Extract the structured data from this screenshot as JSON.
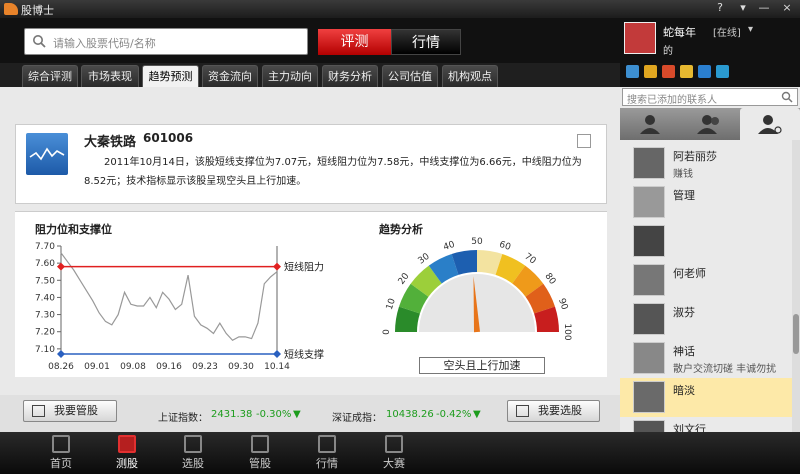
{
  "window": {
    "title": "股博士",
    "controls": [
      "?",
      "—",
      "×"
    ]
  },
  "search": {
    "placeholder": "请输入股票代码/名称"
  },
  "mode_tabs": [
    {
      "label": "评测",
      "active": true
    },
    {
      "label": "行情",
      "active": false
    }
  ],
  "tabs": [
    {
      "label": "综合评测",
      "active": false
    },
    {
      "label": "市场表现",
      "active": false
    },
    {
      "label": "趋势预测",
      "active": true
    },
    {
      "label": "资金流向",
      "active": false
    },
    {
      "label": "主力动向",
      "active": false
    },
    {
      "label": "财务分析",
      "active": false
    },
    {
      "label": "公司估值",
      "active": false
    },
    {
      "label": "机构观点",
      "active": false
    }
  ],
  "stock": {
    "name": "大秦铁路",
    "code": "601006",
    "description": "2011年10月14日，该股短线支撑位为7.07元，短线阻力位为7.58元，中线支撑位为6.66元，中线阻力位为8.52元；技术指标显示该股呈现空头且上行加速。"
  },
  "chart_data": [
    {
      "type": "line",
      "title": "阻力位和支撑位",
      "x": [
        "08.26",
        "09.01",
        "09.08",
        "09.16",
        "09.23",
        "09.30",
        "10.14"
      ],
      "series": [
        {
          "values": [
            7.66,
            7.61,
            7.56,
            7.5,
            7.44,
            7.38,
            7.31,
            7.26,
            7.24,
            7.3,
            7.43,
            7.36,
            7.35,
            7.35,
            7.4,
            7.34,
            7.43,
            7.39,
            7.33,
            7.36,
            7.53,
            7.29,
            7.24,
            7.22,
            7.19,
            7.25,
            7.19,
            7.15,
            7.17,
            7.17,
            7.16,
            7.25,
            7.48,
            7.52,
            7.55
          ]
        },
        {
          "name": "短线阻力",
          "values": [
            7.58
          ],
          "color": "#e02020"
        },
        {
          "name": "短线支撑",
          "values": [
            7.07
          ],
          "color": "#2a60c0"
        }
      ],
      "ylim": [
        7.07,
        7.7
      ],
      "yticks": [
        "7.70",
        "7.60",
        "7.50",
        "7.40",
        "7.30",
        "7.20",
        "7.10"
      ],
      "grid": false
    }
  ],
  "gauge": {
    "title": "趋势分析",
    "ticks": [
      "0",
      "10",
      "20",
      "30",
      "40",
      "50",
      "60",
      "70",
      "80",
      "90",
      "100"
    ],
    "value": 48,
    "label": "空头且上行加速"
  },
  "bottom_bar": {
    "left_button": "我要管股",
    "right_button": "我要选股",
    "sh_label": "上证指数：",
    "sh_value": "2431.38",
    "sh_change": "-0.30%",
    "sz_label": "深证成指：",
    "sz_value": "10438.26",
    "sz_change": "-0.42%",
    "down_color": "#1c9c1c"
  },
  "user": {
    "name": "蛇每年",
    "status": "[在线]",
    "sub": "的"
  },
  "contacts_search_placeholder": "搜索已添加的联系人",
  "contacts": [
    {
      "name": "阿若丽莎",
      "sig": "赚钱"
    },
    {
      "name": "管理",
      "sig": ""
    },
    {
      "name": "",
      "sig": ""
    },
    {
      "name": "何老师",
      "sig": ""
    },
    {
      "name": "淑芬",
      "sig": ""
    },
    {
      "name": "神话",
      "sig": "散户交流切磋 丰诚勿扰"
    },
    {
      "name": "暗淡",
      "sig": ""
    },
    {
      "name": "刘文行",
      "sig": ""
    }
  ],
  "nav": [
    {
      "label": "首页",
      "active": false
    },
    {
      "label": "测股",
      "active": true
    },
    {
      "label": "选股",
      "active": false
    },
    {
      "label": "管股",
      "active": false
    },
    {
      "label": "行情",
      "active": false
    },
    {
      "label": "大赛",
      "active": false
    }
  ]
}
